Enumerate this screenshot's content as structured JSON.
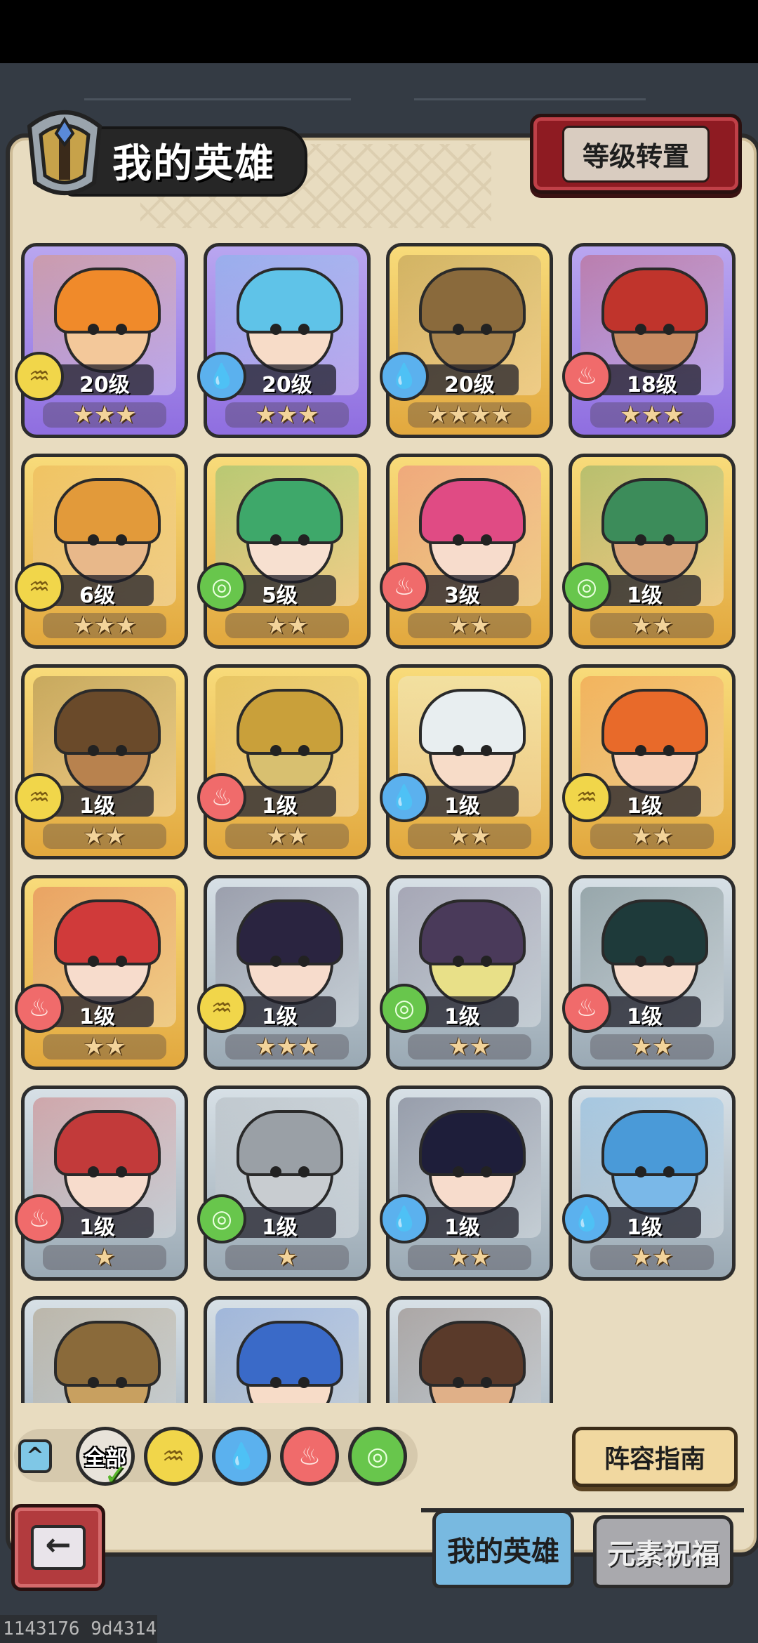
{
  "header": {
    "title": "我的英雄",
    "level_transfer_button": "等级转置"
  },
  "heroes": [
    {
      "level": "20级",
      "stars": "★★★",
      "element": "earth",
      "frame": "purple",
      "hair_color": "#f08a2a",
      "skin": "#f3c89a"
    },
    {
      "level": "20级",
      "stars": "★★★",
      "element": "water",
      "frame": "purple",
      "hair_color": "#5fc3e8",
      "skin": "#f7dcc8"
    },
    {
      "level": "20级",
      "stars": "★★★★",
      "element": "water",
      "frame": "gold",
      "hair_color": "#8a6a3c",
      "skin": "#a8844e"
    },
    {
      "level": "18级",
      "stars": "★★★",
      "element": "fire",
      "frame": "purple",
      "hair_color": "#c0342c",
      "skin": "#c88c62"
    },
    {
      "level": "6级",
      "stars": "★★★",
      "element": "earth",
      "frame": "gold",
      "hair_color": "#e29a3a",
      "skin": "#e8b88a"
    },
    {
      "level": "5级",
      "stars": "★★",
      "element": "wind",
      "frame": "gold",
      "hair_color": "#3ea86a",
      "skin": "#f7e0d0"
    },
    {
      "level": "3级",
      "stars": "★★",
      "element": "fire",
      "frame": "gold",
      "hair_color": "#e04b84",
      "skin": "#f7dccc"
    },
    {
      "level": "1级",
      "stars": "★★",
      "element": "wind",
      "frame": "gold",
      "hair_color": "#3c8c5a",
      "skin": "#d8a47a"
    },
    {
      "level": "1级",
      "stars": "★★",
      "element": "earth",
      "frame": "gold",
      "hair_color": "#6a4a2a",
      "skin": "#b8824e"
    },
    {
      "level": "1级",
      "stars": "★★",
      "element": "fire",
      "frame": "gold",
      "hair_color": "#c9a03a",
      "skin": "#d8c070"
    },
    {
      "level": "1级",
      "stars": "★★",
      "element": "water",
      "frame": "gold",
      "hair_color": "#e8eef0",
      "skin": "#f7dcc8"
    },
    {
      "level": "1级",
      "stars": "★★",
      "element": "earth",
      "frame": "gold",
      "hair_color": "#e86a2a",
      "skin": "#f7d0b8"
    },
    {
      "level": "1级",
      "stars": "★★",
      "element": "fire",
      "frame": "gold",
      "hair_color": "#d03a3a",
      "skin": "#f7dccc"
    },
    {
      "level": "1级",
      "stars": "★★★",
      "element": "earth",
      "frame": "silver",
      "hair_color": "#2a2440",
      "skin": "#f7dccc"
    },
    {
      "level": "1级",
      "stars": "★★",
      "element": "wind",
      "frame": "silver",
      "hair_color": "#4a3a5a",
      "skin": "#e8e088"
    },
    {
      "level": "1级",
      "stars": "★★",
      "element": "fire",
      "frame": "silver",
      "hair_color": "#1e3a3a",
      "skin": "#f7dccc"
    },
    {
      "level": "1级",
      "stars": "★",
      "element": "fire",
      "frame": "silver",
      "hair_color": "#c23a3a",
      "skin": "#f7dccc"
    },
    {
      "level": "1级",
      "stars": "★",
      "element": "wind",
      "frame": "silver",
      "hair_color": "#9aa0a6",
      "skin": "#c8ccd0"
    },
    {
      "level": "1级",
      "stars": "★★",
      "element": "water",
      "frame": "silver",
      "hair_color": "#1e1e3a",
      "skin": "#f7dccc"
    },
    {
      "level": "1级",
      "stars": "★★",
      "element": "water",
      "frame": "silver",
      "hair_color": "#4a9ad8",
      "skin": "#7ab8e8"
    },
    {
      "level": "",
      "stars": "",
      "element": "",
      "frame": "silver",
      "hair_color": "#8a6a3a",
      "skin": "#c8a060"
    },
    {
      "level": "",
      "stars": "",
      "element": "",
      "frame": "silver",
      "hair_color": "#3a6ac8",
      "skin": "#f7dcc8"
    },
    {
      "level": "",
      "stars": "",
      "element": "",
      "frame": "silver",
      "hair_color": "#5a3a2a",
      "skin": "#e0b088"
    }
  ],
  "filters": {
    "all_label": "全部",
    "elements": [
      "earth",
      "water",
      "fire",
      "wind"
    ]
  },
  "lineup_guide_button": "阵容指南",
  "tabs": {
    "my_heroes": "我的英雄",
    "element_blessing": "元素祝福"
  },
  "build_id": "1143176 9d4314",
  "element_colors": {
    "earth": "#f1d64a",
    "water": "#5bb1ee",
    "fire": "#f06b6b",
    "wind": "#68c64c"
  }
}
